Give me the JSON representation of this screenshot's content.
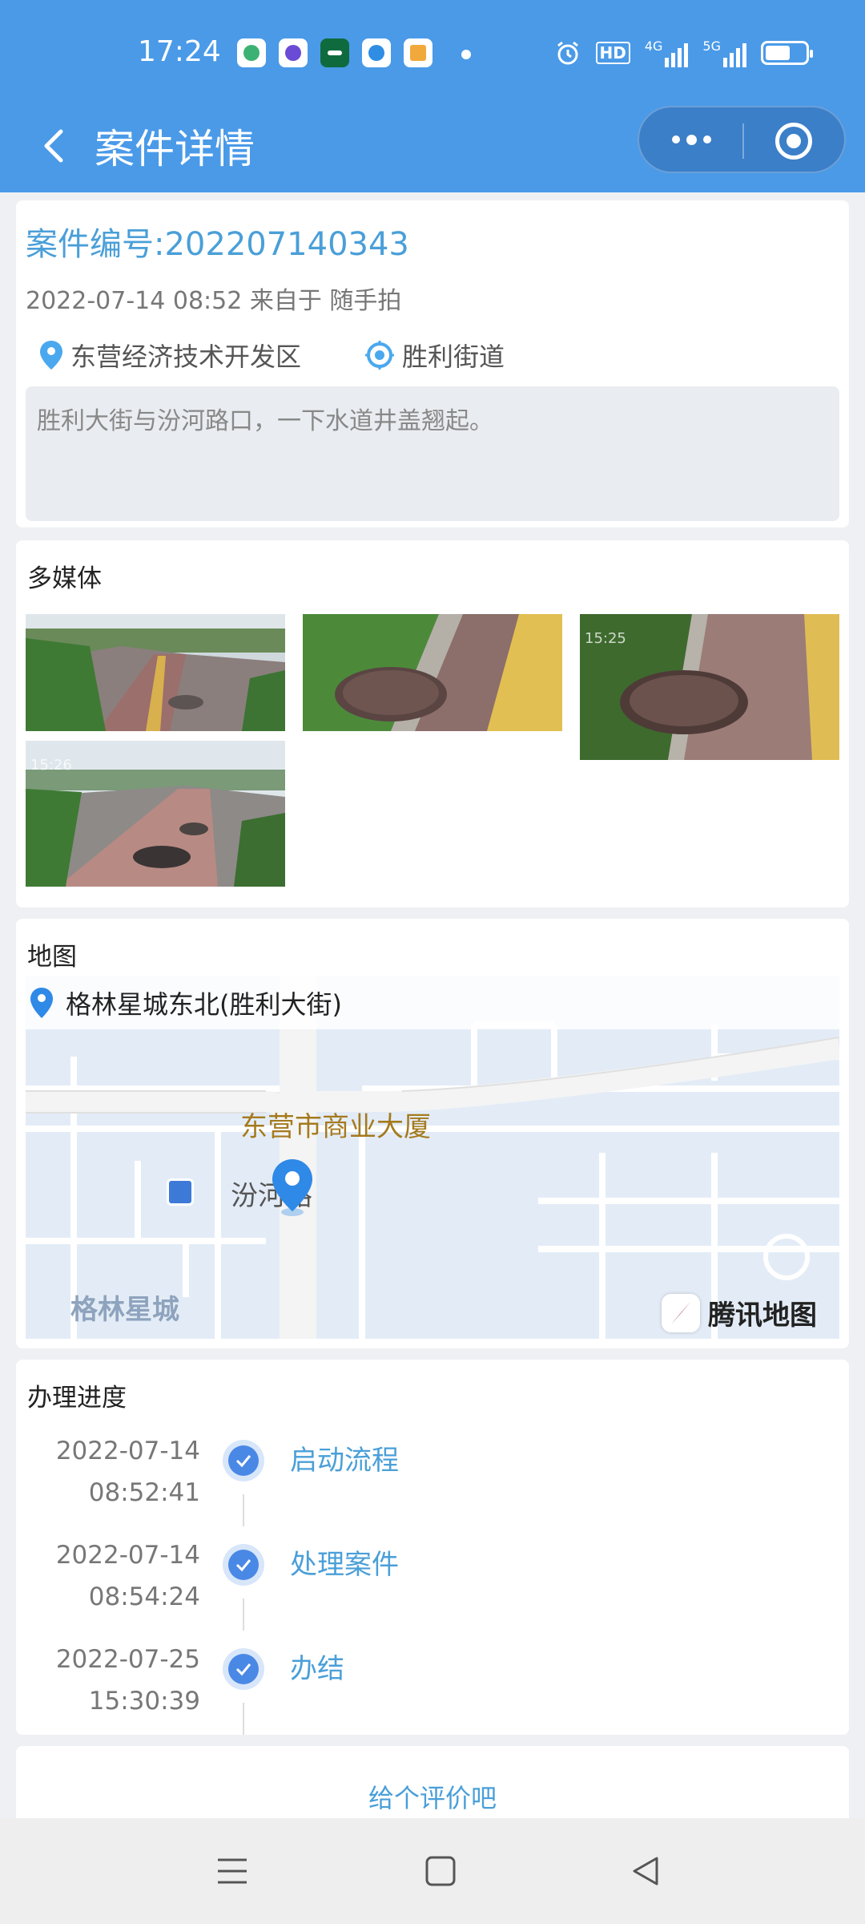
{
  "status_bar": {
    "time": "17:24",
    "app_icons": [
      "video-app-icon",
      "podcast-app-icon",
      "oppo-app-icon",
      "telegram-app-icon",
      "wallet-app-icon"
    ],
    "network_labels": [
      "HD",
      "4G",
      "5G"
    ]
  },
  "nav": {
    "title": "案件详情"
  },
  "case": {
    "number": "案件编号:202207140343",
    "meta": "2022-07-14 08:52 来自于 随手拍",
    "district": "东营经济技术开发区",
    "street": "胜利街道",
    "description": "胜利大街与汾河路口，一下水道井盖翘起。"
  },
  "media": {
    "title": "多媒体",
    "photo_times": [
      "",
      "",
      "15:25",
      "15:26"
    ]
  },
  "map": {
    "title": "地图",
    "address": "格林星城东北(胜利大街)",
    "label_building": "东营市商业大厦",
    "label_road": "汾河路",
    "label_area": "格林星城",
    "logo": "腾讯地图"
  },
  "progress": {
    "title": "办理进度",
    "steps": [
      {
        "date": "2022-07-14",
        "time": "08:52:41",
        "label": "启动流程"
      },
      {
        "date": "2022-07-14",
        "time": "08:54:24",
        "label": "处理案件"
      },
      {
        "date": "2022-07-25",
        "time": "15:30:39",
        "label": "办结"
      }
    ]
  },
  "rating": {
    "prompt": "给个评价吧"
  },
  "colors": {
    "primary": "#4a9ae8",
    "link": "#4a9fd8",
    "check": "#4a88e6"
  }
}
